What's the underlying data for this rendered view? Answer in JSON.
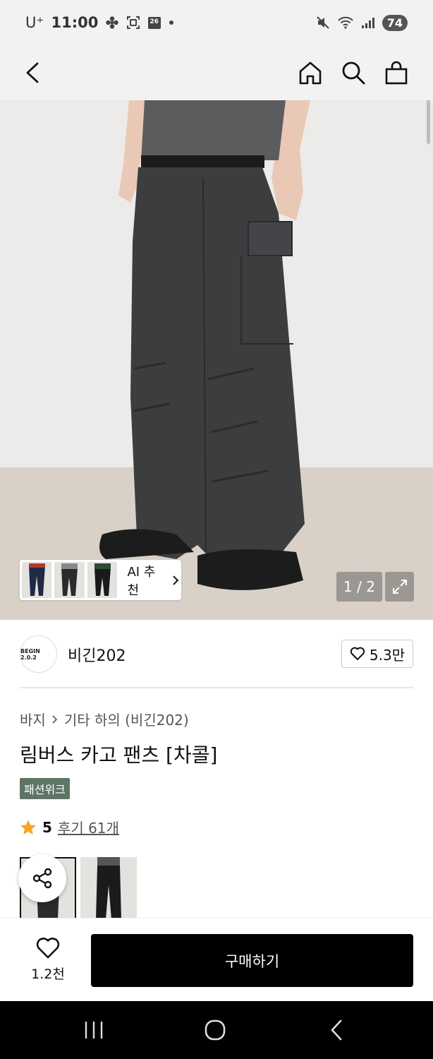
{
  "status_bar": {
    "carrier": "U⁺",
    "time": "11:00",
    "calendar_day": "26",
    "battery": "74"
  },
  "app_bar": {
    "icons": [
      "back-arrow-icon",
      "home-icon",
      "search-icon",
      "shopping-bag-icon"
    ]
  },
  "gallery": {
    "ai_recommend_label": "AI 추천",
    "page_counter": "1 / 2",
    "thumb_count": 3
  },
  "brand": {
    "logo_text": "BEGIN 2.0.2",
    "name": "비긴202",
    "like_count": "5.3만"
  },
  "product": {
    "breadcrumb": [
      "바지",
      "기타 하의 (비긴202)"
    ],
    "title": "림버스 카고 팬츠 [차콜]",
    "badge": "패션위크",
    "rating": "5",
    "review_label": "후기 61개"
  },
  "action_bar": {
    "wish_count": "1.2천",
    "buy_label": "구매하기"
  },
  "colors": {
    "badge": "#5e7566",
    "star": "#f5a623",
    "buy_button": "#000000"
  }
}
